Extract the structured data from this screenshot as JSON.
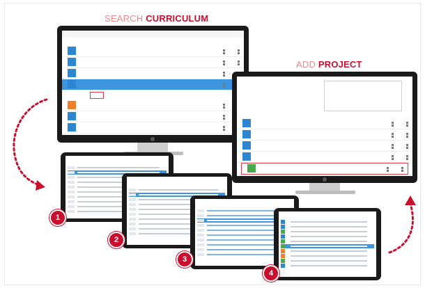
{
  "headings": {
    "search_light": "SEARCH ",
    "search_bold": "CURRICULUM",
    "add_light": "ADD ",
    "add_bold": "PROJECT"
  },
  "steps": [
    "1",
    "2",
    "3",
    "4"
  ],
  "colors": {
    "accent": "#c8102e",
    "row_blue": "#2c86d2",
    "highlight": "#3d95e0",
    "orange": "#f07f2a",
    "green": "#48a94e"
  }
}
